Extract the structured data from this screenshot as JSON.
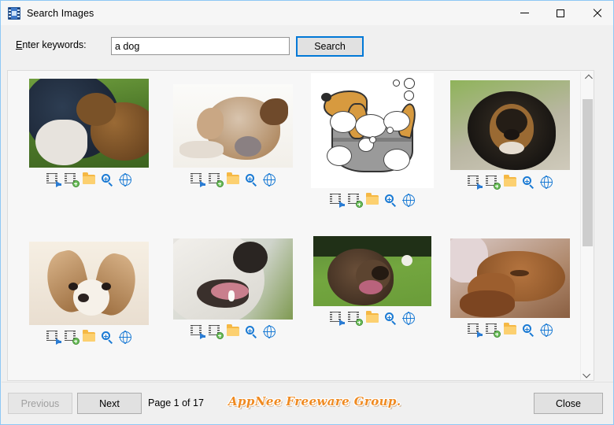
{
  "window": {
    "title": "Search Images",
    "app_icon": "film-strip-icon",
    "minimize_label": "Minimize",
    "maximize_label": "Maximize",
    "close_label": "Close"
  },
  "search": {
    "label": "Enter keywords:",
    "label_accel": "E",
    "label_rest": "nter keywords:",
    "value": "a dog",
    "placeholder": "",
    "button_label": "Search"
  },
  "results": {
    "scroll": {
      "up_icon": "chevron-up-icon",
      "down_icon": "chevron-down-icon",
      "thumb_top_pct": 5,
      "thumb_height_pct": 52
    },
    "item_actions": [
      {
        "name": "open-in-viewer-icon",
        "title": "Open"
      },
      {
        "name": "add-to-list-icon",
        "title": "Add"
      },
      {
        "name": "open-folder-icon",
        "title": "Folder"
      },
      {
        "name": "zoom-in-icon",
        "title": "Preview"
      },
      {
        "name": "open-web-page-icon",
        "title": "Open page"
      }
    ],
    "items": [
      {
        "alt": "Person kneeling on grass petting a brown dog",
        "style": "grass-person-dog"
      },
      {
        "alt": "Tan and white dog lying down on white background",
        "style": "lying-dog-white"
      },
      {
        "alt": "Cartoon dog taking a bath in a washtub with soap bubbles",
        "style": "cartoon-bath-dog"
      },
      {
        "alt": "Black and tan long-haired dog facing camera",
        "style": "black-tan-dog"
      },
      {
        "alt": "Two papillon puppies with large fluffy ears",
        "style": "papillon-puppies"
      },
      {
        "alt": "Close-up of white dog's open mouth and muzzle",
        "style": "white-dog-muzzle"
      },
      {
        "alt": "Chocolate labrador smiling in a green field",
        "style": "lab-in-grass"
      },
      {
        "alt": "Two reddish brown puppies sleeping together",
        "style": "sleeping-puppies"
      }
    ]
  },
  "footer": {
    "previous_label": "Previous",
    "previous_disabled": true,
    "next_label": "Next",
    "page_info": "Page 1 of 17",
    "watermark": "AppNee Freeware Group.",
    "close_label": "Close"
  },
  "colors": {
    "accent": "#0078d7",
    "window_border": "#8ec8f5",
    "chrome": "#f0f0f0",
    "watermark": "#ef8a21"
  }
}
